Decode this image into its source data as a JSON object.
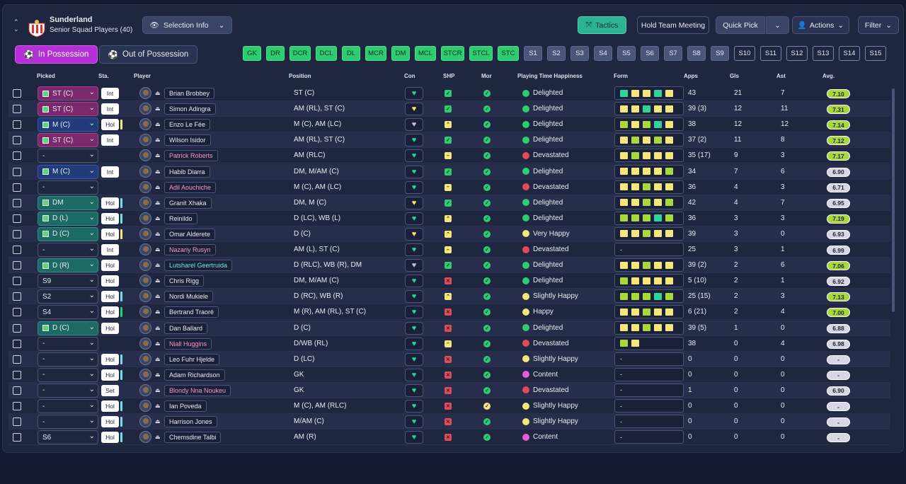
{
  "header": {
    "club": "Sunderland",
    "subtitle": "Senior Squad Players (40)",
    "selection_info": "Selection Info",
    "tactics": "Tactics",
    "hold_meeting": "Hold Team Meeting",
    "quick_pick": "Quick Pick",
    "actions": "Actions",
    "filter": "Filter"
  },
  "toggles": {
    "in_possession": "In Possession",
    "out_possession": "Out of Possession"
  },
  "chips": [
    {
      "label": "GK",
      "kind": "pos"
    },
    {
      "label": "DR",
      "kind": "pos"
    },
    {
      "label": "DCR",
      "kind": "pos"
    },
    {
      "label": "DCL",
      "kind": "pos"
    },
    {
      "label": "DL",
      "kind": "pos"
    },
    {
      "label": "MCR",
      "kind": "pos"
    },
    {
      "label": "DM",
      "kind": "pos"
    },
    {
      "label": "MCL",
      "kind": "pos"
    },
    {
      "label": "STCR",
      "kind": "pos"
    },
    {
      "label": "STCL",
      "kind": "pos"
    },
    {
      "label": "STC",
      "kind": "pos"
    },
    {
      "label": "S1",
      "kind": "s1"
    },
    {
      "label": "S2",
      "kind": "s1"
    },
    {
      "label": "S3",
      "kind": "s1"
    },
    {
      "label": "S4",
      "kind": "s1"
    },
    {
      "label": "S5",
      "kind": "s1"
    },
    {
      "label": "S6",
      "kind": "s1"
    },
    {
      "label": "S7",
      "kind": "s1"
    },
    {
      "label": "S8",
      "kind": "s1"
    },
    {
      "label": "S9",
      "kind": "s1"
    },
    {
      "label": "S10",
      "kind": "s2"
    },
    {
      "label": "S11",
      "kind": "s2"
    },
    {
      "label": "S12",
      "kind": "s2"
    },
    {
      "label": "S13",
      "kind": "s2"
    },
    {
      "label": "S14",
      "kind": "s2"
    },
    {
      "label": "S15",
      "kind": "s2"
    }
  ],
  "columns": [
    "Picked",
    "Sta.",
    "Player",
    "Position",
    "Con",
    "SHP",
    "Mor",
    "Playing Time Happiness",
    "Form",
    "Apps",
    "Gls",
    "Ast",
    "Avg."
  ],
  "colors": {
    "green": "#2ecc71",
    "yellow": "#f4e67a",
    "lime": "#a7d93a",
    "teal": "#2ed39a",
    "red": "#e24a5a",
    "pink": "#e65bd6"
  },
  "rows": [
    {
      "picked": "ST (C)",
      "pk": "st",
      "sta": "Int",
      "bar": "",
      "name": "Brian Brobbey",
      "nc": "",
      "pos": "ST (C)",
      "con": "#2ed39a",
      "shp": "g",
      "mor": "g",
      "hap": "Delighted",
      "hc": "#2ecc71",
      "form": [
        "t",
        "y",
        "y",
        "t",
        "y"
      ],
      "apps": "43",
      "gls": "21",
      "ast": "7",
      "avg": "7.10",
      "ac": "#a7d93a"
    },
    {
      "picked": "ST (C)",
      "pk": "st",
      "sta": "Int",
      "bar": "",
      "name": "Simon Adingra",
      "nc": "",
      "pos": "AM (RL), ST (C)",
      "con": "#f4e67a",
      "shp": "g",
      "mor": "g",
      "hap": "Delighted",
      "hc": "#2ecc71",
      "form": [
        "y",
        "y",
        "t",
        "y",
        "y"
      ],
      "apps": "39 (3)",
      "gls": "12",
      "ast": "11",
      "avg": "7.31",
      "ac": "#a7d93a"
    },
    {
      "picked": "M (C)",
      "pk": "m",
      "sta": "Hol",
      "bar": "#f4e67a",
      "name": "Enzo Le Fée",
      "nc": "",
      "pos": "M (C), AM (LC)",
      "con": "#c8b7f0",
      "shp": "yu",
      "mor": "g",
      "hap": "Delighted",
      "hc": "#2ecc71",
      "form": [
        "l",
        "y",
        "l",
        "t",
        "y"
      ],
      "apps": "38",
      "gls": "12",
      "ast": "12",
      "avg": "7.14",
      "ac": "#a7d93a"
    },
    {
      "picked": "ST (C)",
      "pk": "st",
      "sta": "Int",
      "bar": "",
      "name": "Wilson Isidor",
      "nc": "",
      "pos": "AM (RL), ST (C)",
      "con": "#2ed39a",
      "shp": "g",
      "mor": "g",
      "hap": "Delighted",
      "hc": "#2ecc71",
      "form": [
        "y",
        "l",
        "y",
        "l",
        "y"
      ],
      "apps": "37 (2)",
      "gls": "11",
      "ast": "8",
      "avg": "7.12",
      "ac": "#a7d93a"
    },
    {
      "picked": "-",
      "pk": "none",
      "sta": "",
      "bar": "",
      "name": "Patrick Roberts",
      "nc": "pink",
      "pos": "AM (RLC)",
      "con": "#2ed39a",
      "shp": "ym",
      "mor": "g",
      "hap": "Devastated",
      "hc": "#e24a5a",
      "form": [
        "y",
        "l",
        "y",
        "y",
        "y"
      ],
      "apps": "35 (17)",
      "gls": "9",
      "ast": "3",
      "avg": "7.17",
      "ac": "#a7d93a"
    },
    {
      "picked": "M (C)",
      "pk": "m",
      "sta": "Int",
      "bar": "",
      "name": "Habib Diarra",
      "nc": "",
      "pos": "DM, M/AM (C)",
      "con": "#2ed39a",
      "shp": "g",
      "mor": "g",
      "hap": "Delighted",
      "hc": "#2ecc71",
      "form": [
        "y",
        "y",
        "y",
        "y",
        "l"
      ],
      "apps": "34",
      "gls": "7",
      "ast": "6",
      "avg": "6.90",
      "ac": "#d5d8e4"
    },
    {
      "picked": "-",
      "pk": "none",
      "sta": "",
      "bar": "",
      "name": "Adil Aouchiche",
      "nc": "pink",
      "pos": "M (C), AM (LC)",
      "con": "#2ed39a",
      "shp": "ym",
      "mor": "g",
      "hap": "Devastated",
      "hc": "#e24a5a",
      "form": [
        "y",
        "y",
        "l",
        "y",
        "y"
      ],
      "apps": "36",
      "gls": "4",
      "ast": "3",
      "avg": "6.71",
      "ac": "#d5d8e4"
    },
    {
      "picked": "DM",
      "pk": "dm",
      "sta": "Hol",
      "bar": "#6fe0e6",
      "name": "Granit Xhaka",
      "nc": "",
      "pos": "DM, M (C)",
      "con": "#f4e67a",
      "shp": "g",
      "mor": "g",
      "hap": "Delighted",
      "hc": "#2ecc71",
      "form": [
        "y",
        "y",
        "l",
        "y",
        "l"
      ],
      "apps": "42",
      "gls": "4",
      "ast": "7",
      "avg": "6.95",
      "ac": "#d5d8e4"
    },
    {
      "picked": "D (L)",
      "pk": "d",
      "sta": "Hol",
      "bar": "#6fe0e6",
      "name": "Reinildo",
      "nc": "",
      "pos": "D (LC), WB (L)",
      "con": "#2ed39a",
      "shp": "yu",
      "mor": "g",
      "hap": "Delighted",
      "hc": "#2ecc71",
      "form": [
        "l",
        "l",
        "l",
        "t",
        "l"
      ],
      "apps": "36",
      "gls": "3",
      "ast": "3",
      "avg": "7.19",
      "ac": "#a7d93a"
    },
    {
      "picked": "D (C)",
      "pk": "d",
      "sta": "Hol",
      "bar": "#f4e67a",
      "name": "Omar Alderete",
      "nc": "",
      "pos": "D (C)",
      "con": "#f4e67a",
      "shp": "yu",
      "mor": "g",
      "hap": "Very Happy",
      "hc": "#f4e67a",
      "form": [
        "y",
        "y",
        "l",
        "y",
        "y"
      ],
      "apps": "39",
      "gls": "3",
      "ast": "0",
      "avg": "6.93",
      "ac": "#d5d8e4"
    },
    {
      "picked": "-",
      "pk": "none",
      "sta": "Int",
      "bar": "",
      "name": "Nazariy Rusyn",
      "nc": "pink",
      "pos": "AM (L), ST (C)",
      "con": "#2ed39a",
      "shp": "ym",
      "mor": "g",
      "hap": "Devastated",
      "hc": "#e24a5a",
      "form": [],
      "apps": "25",
      "gls": "3",
      "ast": "1",
      "avg": "6.99",
      "ac": "#d5d8e4"
    },
    {
      "picked": "D (R)",
      "pk": "d",
      "sta": "Hol",
      "bar": "",
      "name": "Lutsharel Geertruida",
      "nc": "cyan",
      "pos": "D (RLC), WB (R), DM",
      "con": "#c8b7f0",
      "shp": "g",
      "mor": "g",
      "hap": "Delighted",
      "hc": "#2ecc71",
      "form": [
        "y",
        "y",
        "l",
        "y",
        "y"
      ],
      "apps": "39 (2)",
      "gls": "2",
      "ast": "6",
      "avg": "7.06",
      "ac": "#a7d93a"
    },
    {
      "picked": "S9",
      "pk": "none",
      "sta": "Hol",
      "bar": "",
      "name": "Chris Rigg",
      "nc": "",
      "pos": "DM, M/AM (C)",
      "con": "#2ed39a",
      "shp": "r",
      "mor": "g",
      "hap": "Delighted",
      "hc": "#2ecc71",
      "form": [
        "l",
        "y",
        "y",
        "y",
        "y"
      ],
      "apps": "5 (10)",
      "gls": "2",
      "ast": "1",
      "avg": "6.92",
      "ac": "#d5d8e4"
    },
    {
      "picked": "S2",
      "pk": "none",
      "sta": "Hol",
      "bar": "#6fe0e6",
      "name": "Nordi Mukiele",
      "nc": "",
      "pos": "D (RC), WB (R)",
      "con": "#2ed39a",
      "shp": "yu",
      "mor": "g",
      "hap": "Slightly Happy",
      "hc": "#f4e67a",
      "form": [
        "l",
        "l",
        "l",
        "t",
        "l"
      ],
      "apps": "25 (15)",
      "gls": "2",
      "ast": "3",
      "avg": "7.13",
      "ac": "#a7d93a"
    },
    {
      "picked": "S4",
      "pk": "none",
      "sta": "Hol",
      "bar": "#2ecc71",
      "name": "Bertrand Traoré",
      "nc": "",
      "pos": "M (R), AM (RL), ST (C)",
      "con": "#2ed39a",
      "shp": "r",
      "mor": "g",
      "hap": "Happy",
      "hc": "#f4e67a",
      "form": [
        "y",
        "y",
        "l",
        "y",
        "y"
      ],
      "apps": "6 (21)",
      "gls": "2",
      "ast": "4",
      "avg": "7.00",
      "ac": "#a7d93a"
    },
    {
      "picked": "D (C)",
      "pk": "d",
      "sta": "Hol",
      "bar": "",
      "name": "Dan Ballard",
      "nc": "",
      "pos": "D (C)",
      "con": "#2ed39a",
      "shp": "r",
      "mor": "g",
      "hap": "Delighted",
      "hc": "#2ecc71",
      "form": [
        "y",
        "y",
        "l",
        "y",
        "y"
      ],
      "apps": "39 (5)",
      "gls": "1",
      "ast": "0",
      "avg": "6.88",
      "ac": "#d5d8e4"
    },
    {
      "picked": "-",
      "pk": "none",
      "sta": "",
      "bar": "",
      "name": "Niall Huggins",
      "nc": "pink",
      "pos": "D/WB (RL)",
      "con": "#2ed39a",
      "shp": "ym",
      "mor": "g",
      "hap": "Devastated",
      "hc": "#e24a5a",
      "form": [
        "l",
        "y"
      ],
      "apps": "38",
      "gls": "0",
      "ast": "4",
      "avg": "6.98",
      "ac": "#d5d8e4"
    },
    {
      "picked": "-",
      "pk": "none",
      "sta": "Hol",
      "bar": "#6fe0e6",
      "name": "Leo Fuhr Hjelde",
      "nc": "",
      "pos": "D (LC)",
      "con": "#2ed39a",
      "shp": "r",
      "mor": "g",
      "hap": "Slightly Happy",
      "hc": "#f4e67a",
      "form": [],
      "apps": "0",
      "gls": "0",
      "ast": "0",
      "avg": "-",
      "ac": "#d5d8e4"
    },
    {
      "picked": "-",
      "pk": "none",
      "sta": "Hol",
      "bar": "#6fe0e6",
      "name": "Adam Richardson",
      "nc": "",
      "pos": "GK",
      "con": "#2ed39a",
      "shp": "r",
      "mor": "g",
      "hap": "Content",
      "hc": "#e65bd6",
      "form": [],
      "apps": "0",
      "gls": "0",
      "ast": "0",
      "avg": "-",
      "ac": "#d5d8e4"
    },
    {
      "picked": "-",
      "pk": "none",
      "sta": "Set",
      "bar": "",
      "name": "Blondy Nna Noukeu",
      "nc": "pink",
      "pos": "GK",
      "con": "#2ed39a",
      "shp": "r",
      "mor": "g",
      "hap": "Devastated",
      "hc": "#e24a5a",
      "form": [],
      "apps": "1",
      "gls": "0",
      "ast": "0",
      "avg": "6.90",
      "ac": "#d5d8e4"
    },
    {
      "picked": "-",
      "pk": "none",
      "sta": "Hol",
      "bar": "#6fe0e6",
      "name": "Ian Poveda",
      "nc": "",
      "pos": "M (C), AM (RLC)",
      "con": "#2ed39a",
      "shp": "r",
      "mor": "y",
      "hap": "Slightly Happy",
      "hc": "#f4e67a",
      "form": [],
      "apps": "0",
      "gls": "0",
      "ast": "0",
      "avg": "-",
      "ac": "#d5d8e4"
    },
    {
      "picked": "-",
      "pk": "none",
      "sta": "Hol",
      "bar": "#6fe0e6",
      "name": "Harrison Jones",
      "nc": "",
      "pos": "M/AM (C)",
      "con": "#2ed39a",
      "shp": "r",
      "mor": "g",
      "hap": "Slightly Happy",
      "hc": "#f4e67a",
      "form": [],
      "apps": "0",
      "gls": "0",
      "ast": "0",
      "avg": "-",
      "ac": "#d5d8e4"
    },
    {
      "picked": "S6",
      "pk": "none",
      "sta": "Hol",
      "bar": "#6fe0e6",
      "name": "Chemsdine Talbi",
      "nc": "",
      "pos": "AM (R)",
      "con": "#2ed39a",
      "shp": "r",
      "mor": "g",
      "hap": "Content",
      "hc": "#e65bd6",
      "form": [],
      "apps": "0",
      "gls": "0",
      "ast": "0",
      "avg": "-",
      "ac": "#d5d8e4"
    }
  ]
}
